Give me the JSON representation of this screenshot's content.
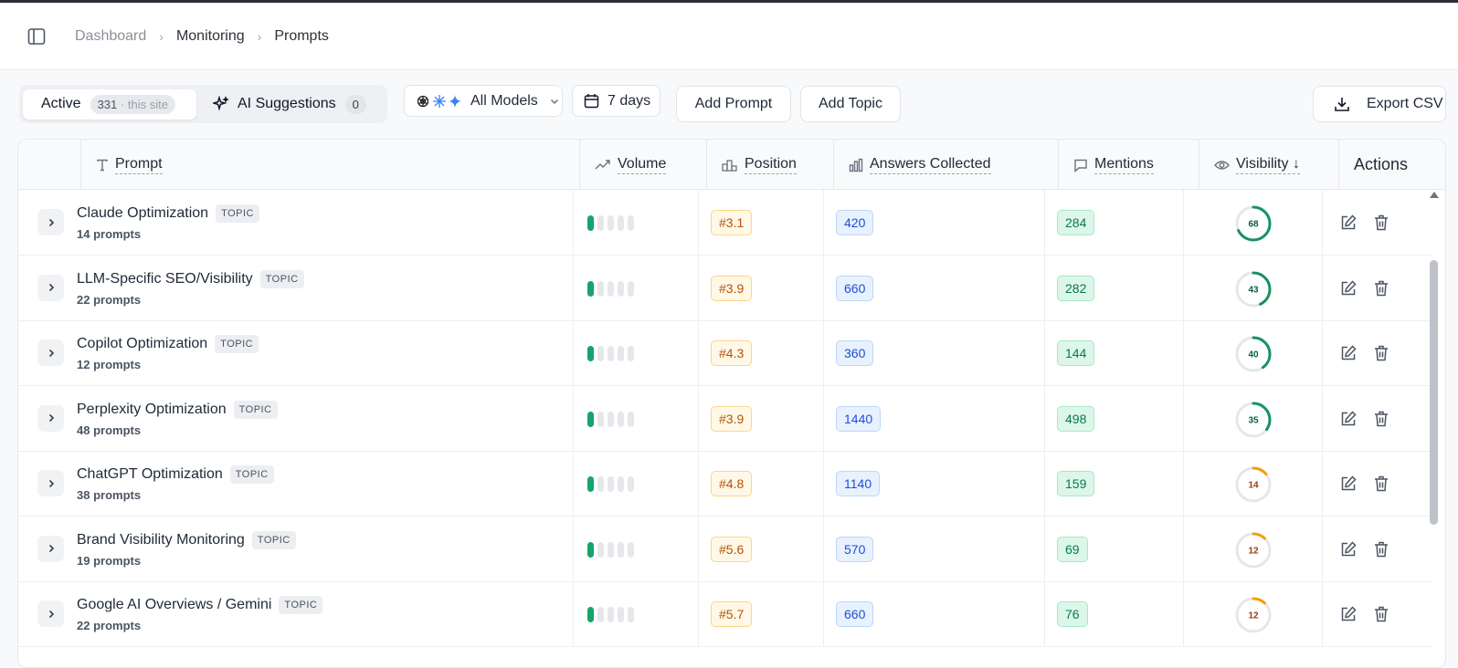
{
  "breadcrumb": {
    "items": [
      "Dashboard",
      "Monitoring",
      "Prompts"
    ]
  },
  "toolbar": {
    "active_label": "Active",
    "active_count": "331",
    "active_suffix": "· this site",
    "suggestions_label": "AI Suggestions",
    "suggestions_count": "0",
    "models_label": "All Models",
    "days_label": "7 days",
    "add_prompt_label": "Add Prompt",
    "add_topic_label": "Add Topic",
    "export_label": "Export CSV"
  },
  "table": {
    "headers": {
      "prompt": "Prompt",
      "volume": "Volume",
      "position": "Position",
      "answers": "Answers Collected",
      "mentions": "Mentions",
      "visibility": "Visibility ↓",
      "actions": "Actions"
    },
    "topic_badge": "TOPIC",
    "rows": [
      {
        "name": "Claude Optimization",
        "count": "14 prompts",
        "volume_level": 1,
        "position": "#3.1",
        "answers": "420",
        "mentions": "284",
        "visibility": "68",
        "visibility_pct": 68,
        "ring_color": "#15935f"
      },
      {
        "name": "LLM-Specific SEO/Visibility",
        "count": "22 prompts",
        "volume_level": 1,
        "position": "#3.9",
        "answers": "660",
        "mentions": "282",
        "visibility": "43",
        "visibility_pct": 43,
        "ring_color": "#15935f"
      },
      {
        "name": "Copilot Optimization",
        "count": "12 prompts",
        "volume_level": 1,
        "position": "#4.3",
        "answers": "360",
        "mentions": "144",
        "visibility": "40",
        "visibility_pct": 40,
        "ring_color": "#15935f"
      },
      {
        "name": "Perplexity Optimization",
        "count": "48 prompts",
        "volume_level": 1,
        "position": "#3.9",
        "answers": "1440",
        "mentions": "498",
        "visibility": "35",
        "visibility_pct": 35,
        "ring_color": "#15935f"
      },
      {
        "name": "ChatGPT Optimization",
        "count": "38 prompts",
        "volume_level": 1,
        "position": "#4.8",
        "answers": "1140",
        "mentions": "159",
        "visibility": "14",
        "visibility_pct": 14,
        "ring_color": "#f59e0b"
      },
      {
        "name": "Brand Visibility Monitoring",
        "count": "19 prompts",
        "volume_level": 1,
        "position": "#5.6",
        "answers": "570",
        "mentions": "69",
        "visibility": "12",
        "visibility_pct": 12,
        "ring_color": "#f59e0b"
      },
      {
        "name": "Google AI Overviews / Gemini",
        "count": "22 prompts",
        "volume_level": 1,
        "position": "#5.7",
        "answers": "660",
        "mentions": "76",
        "visibility": "12",
        "visibility_pct": 12,
        "ring_color": "#f59e0b"
      }
    ]
  }
}
